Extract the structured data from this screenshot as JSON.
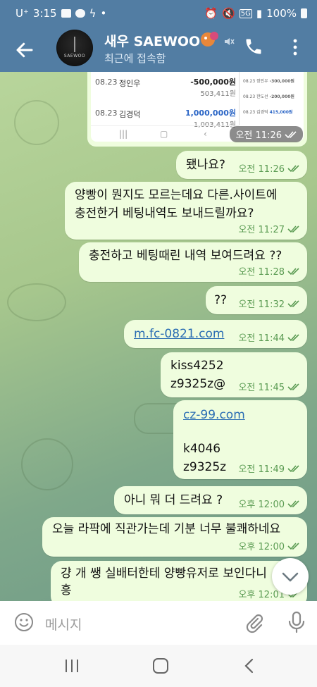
{
  "statusbar": {
    "carrier": "U⁺",
    "time": "3:15",
    "battery": "100%",
    "network": "5G"
  },
  "header": {
    "title": "새우 SAEWOO",
    "subtitle": "최근에 접속함",
    "avatar_text": "SAEWOO"
  },
  "screenshot": {
    "rows": [
      {
        "date": "08.23",
        "name": "정인우",
        "amount": "-500,000원",
        "balance": "503,411원",
        "amount_color": "#222222"
      },
      {
        "date": "08.23",
        "name": "김경덕",
        "amount": "1,000,000원",
        "balance": "1,003,411원",
        "amount_color": "#2c66c6"
      }
    ],
    "right_rows": [
      {
        "date": "08.23",
        "name": "정인우",
        "amount": "-300,000원"
      },
      {
        "date": "08.23",
        "name": "한도선",
        "amount": "-200,000원"
      },
      {
        "date": "08.23",
        "name": "김경덕",
        "amount": "415,000원"
      }
    ],
    "time": "오전 11:26"
  },
  "messages": [
    {
      "text": "됐나요?",
      "time": "오전 11:26"
    },
    {
      "text": "양빵이 뭔지도 모르는데요 다른.사이트에\n충전한거 베팅내역도 보내드릴까요?",
      "time": "오전 11:27"
    },
    {
      "text": "충전하고 베팅때린 내역 보여드려요 ??",
      "time": "오전 11:28"
    },
    {
      "text": "??",
      "time": "오전 11:32"
    },
    {
      "text": "m.fc-0821.com",
      "time": "오전 11:44"
    },
    {
      "text": "kiss4252\nz9325z@",
      "time": "오전 11:45"
    },
    {
      "link": "cz-99.com",
      "text": "k4046\nz9325z",
      "time": "오전 11:49"
    },
    {
      "text": "아니 뭐 더 드려요 ?",
      "time": "오후 12:00"
    },
    {
      "text": "오늘 라팍에 직관가는데 기분 너무 불쾌하네요",
      "time": "오후 12:00"
    },
    {
      "text": "걍 개 쌩 실배터한테 양빵유저로 보인다니\n흥",
      "time": "오후 12:01"
    }
  ],
  "composer": {
    "placeholder": "메시지"
  },
  "colors": {
    "header": "#527da3",
    "bubble": "#effdde",
    "time": "#5a9b52",
    "link": "#2a6db3"
  }
}
